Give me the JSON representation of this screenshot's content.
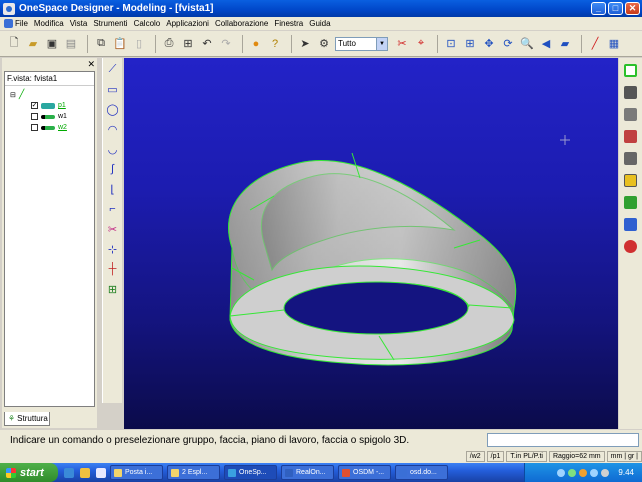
{
  "window": {
    "title": "OneSpace Designer - Modeling - [fvista1]"
  },
  "menu": [
    "File",
    "Modifica",
    "Vista",
    "Strumenti",
    "Calcolo",
    "Applicazioni",
    "Collaborazione",
    "Finestra",
    "Guida"
  ],
  "toolbar": {
    "filter_value": "Tutto"
  },
  "tree": {
    "root_label": "F.vista: fvista1",
    "items": [
      {
        "label": "p1",
        "checked": true
      },
      {
        "label": "w1",
        "checked": false
      },
      {
        "label": "w2",
        "checked": false
      }
    ],
    "tab_label": "Struttura"
  },
  "status": {
    "message": "Indicare un comando o preselezionare gruppo, faccia, piano di lavoro, faccia o spigolo 3D.",
    "input_value": ""
  },
  "infobar": [
    "/w2",
    "/p1",
    "T.in PL/P.ti",
    "Raggio=62 mm",
    "mm | gr |"
  ],
  "taskbar": {
    "start_label": "start",
    "tasks": [
      "Posta i...",
      "2 Espl...",
      "OneSp...",
      "RealOn...",
      "OSDM -...",
      "osd.do..."
    ],
    "clock": "9.44"
  },
  "colors": {
    "viewport_top": "#2323c8",
    "viewport_bottom": "#0b0b4a",
    "edge": "#36e836"
  }
}
